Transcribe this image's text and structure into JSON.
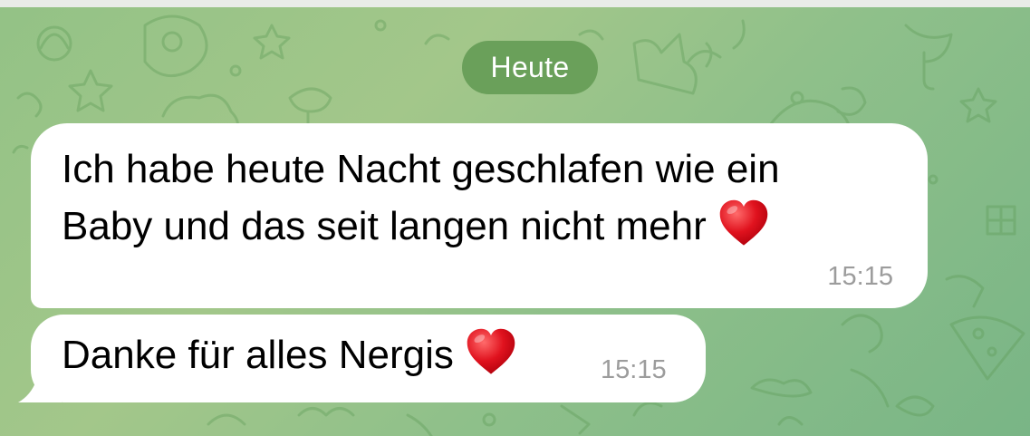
{
  "chat": {
    "date_divider": "Heute",
    "messages": [
      {
        "lines": [
          "Ich habe heute Nacht geschlafen wie ein",
          "Baby und das seit langen nicht mehr"
        ],
        "emoji": "red-heart",
        "time": "15:15"
      },
      {
        "lines": [
          "Danke für alles Nergis"
        ],
        "emoji": "red-heart",
        "time": "15:15"
      }
    ]
  },
  "colors": {
    "wallpaper": "#93c286",
    "date_pill": "#6aa05a",
    "bubble": "#ffffff",
    "timestamp": "#9c9c9c",
    "heart": "#e0121e"
  }
}
